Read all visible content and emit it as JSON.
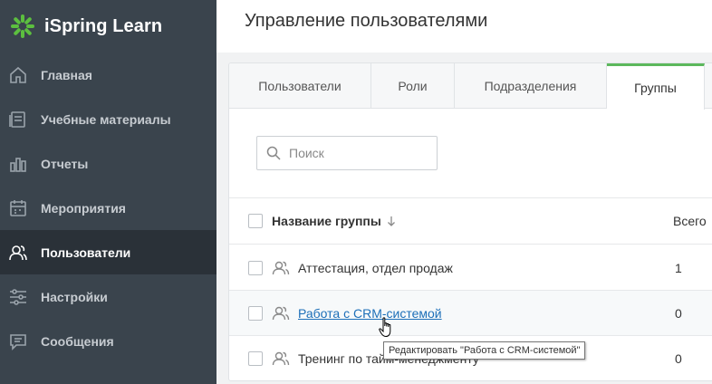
{
  "app": {
    "name": "iSpring Learn",
    "logo_icon": "ispring-logo-icon",
    "accent": "#5cb85c"
  },
  "sidebar": {
    "items": [
      {
        "label": "Главная",
        "icon": "home-icon",
        "active": false
      },
      {
        "label": "Учебные материалы",
        "icon": "materials-icon",
        "active": false
      },
      {
        "label": "Отчеты",
        "icon": "chart-icon",
        "active": false
      },
      {
        "label": "Мероприятия",
        "icon": "calendar-icon",
        "active": false
      },
      {
        "label": "Пользователи",
        "icon": "users-icon",
        "active": true
      },
      {
        "label": "Настройки",
        "icon": "settings-icon",
        "active": false
      },
      {
        "label": "Сообщения",
        "icon": "messages-icon",
        "active": false
      }
    ]
  },
  "header": {
    "title": "Управление пользователями"
  },
  "tabs": [
    {
      "label": "Пользователи",
      "active": false
    },
    {
      "label": "Роли",
      "active": false
    },
    {
      "label": "Подразделения",
      "active": false
    },
    {
      "label": "Группы",
      "active": true
    }
  ],
  "search": {
    "placeholder": "Поиск",
    "value": ""
  },
  "table": {
    "columns": {
      "name": "Название группы",
      "total": "Всего"
    },
    "rows": [
      {
        "name": "Аттестация, отдел продаж",
        "count": "1"
      },
      {
        "name": "Работа с CRM-системой",
        "count": "0",
        "hovered": true
      },
      {
        "name": "Тренинг по тайм-менеджменту",
        "count": "0"
      }
    ]
  },
  "tooltip": {
    "text": "Редактировать \"Работа с CRM-системой\""
  }
}
